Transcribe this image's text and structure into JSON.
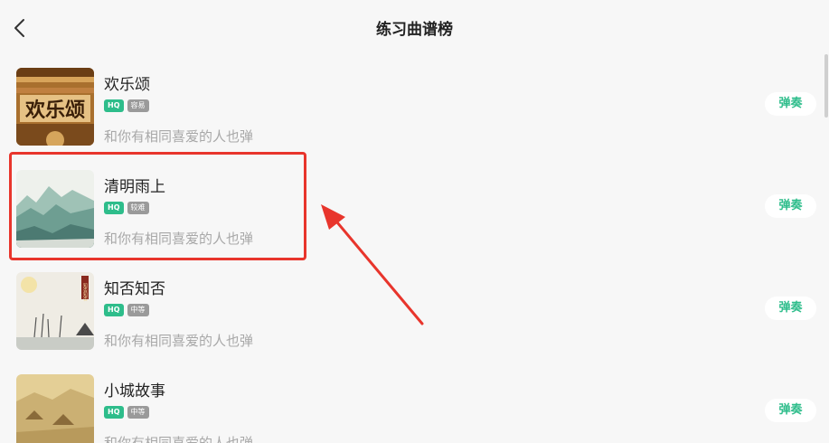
{
  "header": {
    "title": "练习曲谱榜",
    "back_icon": "chevron-left-icon"
  },
  "songs": [
    {
      "title": "欢乐颂",
      "hq": "HQ",
      "difficulty": "容易",
      "desc": "和你有相同喜爱的人也弹",
      "play": "弹奏",
      "cover_text": "欢乐颂"
    },
    {
      "title": "清明雨上",
      "hq": "HQ",
      "difficulty": "较难",
      "desc": "和你有相同喜爱的人也弹",
      "play": "弹奏"
    },
    {
      "title": "知否知否",
      "hq": "HQ",
      "difficulty": "中等",
      "desc": "和你有相同喜爱的人也弹",
      "play": "弹奏",
      "cover_text": "知否知否"
    },
    {
      "title": "小城故事",
      "hq": "HQ",
      "difficulty": "中等",
      "desc": "和你有相同喜爱的人也弹",
      "play": "弹奏"
    }
  ],
  "annotation": {
    "highlight_color": "#e8352c",
    "arrow_color": "#e8352c"
  },
  "colors": {
    "accent": "#2ebd8b",
    "background": "#f7f7f7",
    "muted_text": "#a8a8a8"
  }
}
